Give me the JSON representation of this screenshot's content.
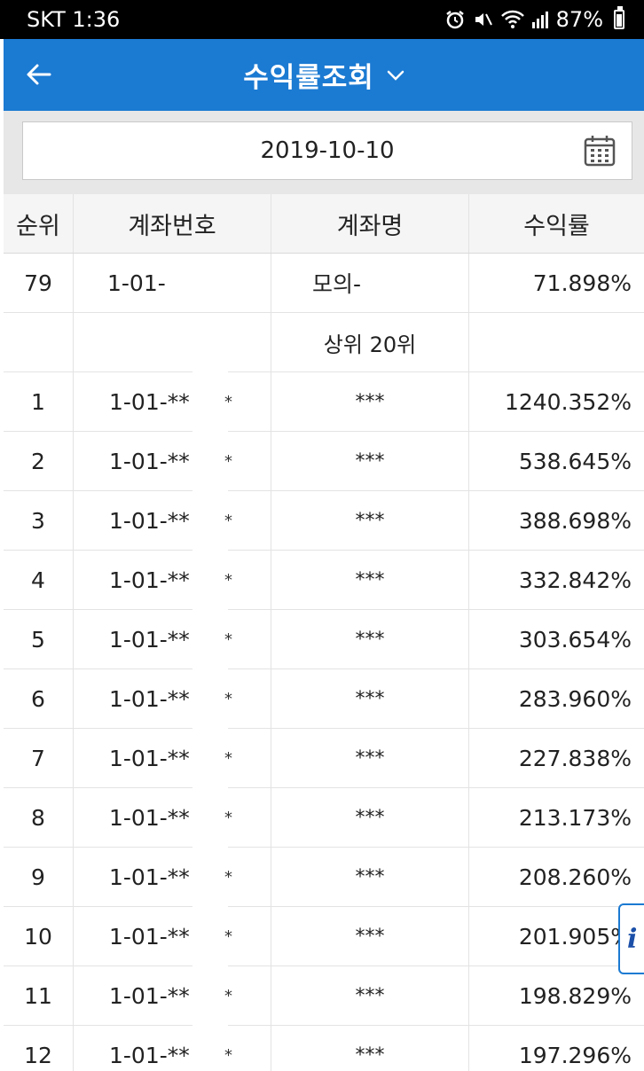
{
  "status": {
    "carrier_time": "SKT 1:36",
    "battery": "87%"
  },
  "appbar": {
    "title": "수익률조회"
  },
  "date": {
    "value": "2019-10-10"
  },
  "table": {
    "headers": {
      "rank": "순위",
      "account": "계좌번호",
      "name": "계좌명",
      "rate": "수익률"
    },
    "my_row": {
      "rank": "79",
      "account": "1-01-",
      "name": "모의-",
      "rate": "71.898%"
    },
    "section_label": "상위 20위",
    "rows": [
      {
        "rank": "1",
        "account": "1-01-**",
        "name": "***",
        "rate": "1240.352%"
      },
      {
        "rank": "2",
        "account": "1-01-**",
        "name": "***",
        "rate": "538.645%"
      },
      {
        "rank": "3",
        "account": "1-01-**",
        "name": "***",
        "rate": "388.698%"
      },
      {
        "rank": "4",
        "account": "1-01-**",
        "name": "***",
        "rate": "332.842%"
      },
      {
        "rank": "5",
        "account": "1-01-**",
        "name": "***",
        "rate": "303.654%"
      },
      {
        "rank": "6",
        "account": "1-01-**",
        "name": "***",
        "rate": "283.960%"
      },
      {
        "rank": "7",
        "account": "1-01-**",
        "name": "***",
        "rate": "227.838%"
      },
      {
        "rank": "8",
        "account": "1-01-**",
        "name": "***",
        "rate": "213.173%"
      },
      {
        "rank": "9",
        "account": "1-01-**",
        "name": "***",
        "rate": "208.260%"
      },
      {
        "rank": "10",
        "account": "1-01-**",
        "name": "***",
        "rate": "201.905%"
      },
      {
        "rank": "11",
        "account": "1-01-**",
        "name": "***",
        "rate": "198.829%"
      },
      {
        "rank": "12",
        "account": "1-01-**",
        "name": "***",
        "rate": "197.296%"
      }
    ],
    "trailing_mark": "*"
  },
  "fab": {
    "label": "i"
  },
  "colors": {
    "appbar": "#1b7ad2",
    "statusbar": "#000000",
    "datebar": "#e7e7e7"
  },
  "icons": [
    "back-arrow-icon",
    "chevron-down-icon",
    "calendar-icon",
    "chevron-right-icon",
    "info-icon",
    "alarm-icon",
    "mute-icon",
    "wifi-icon",
    "signal-icon",
    "battery-icon"
  ]
}
